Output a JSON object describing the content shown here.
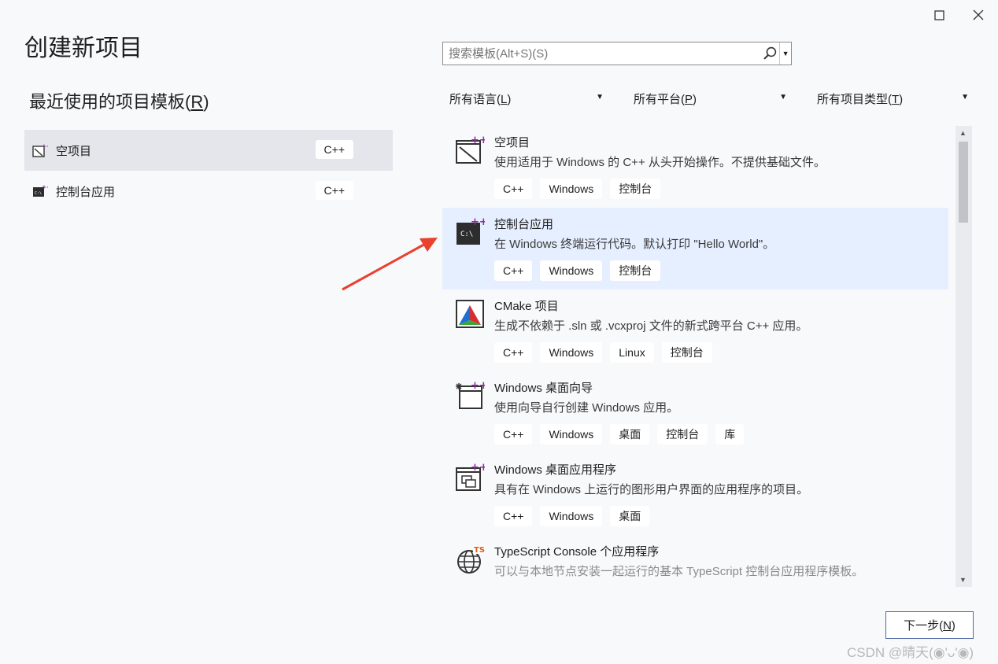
{
  "window": {
    "title": "创建新项目",
    "maximize_icon": "maximize-icon",
    "close_icon": "close-icon"
  },
  "recent": {
    "title_prefix": "最近使用的项目模板(",
    "title_hotkey": "R",
    "title_suffix": ")",
    "items": [
      {
        "label": "空项目",
        "tag": "C++",
        "icon": "empty-project-icon",
        "selected": true
      },
      {
        "label": "控制台应用",
        "tag": "C++",
        "icon": "console-app-icon",
        "selected": false
      }
    ]
  },
  "search": {
    "placeholder": "搜索模板(Alt+S)(S)",
    "icon": "search-icon"
  },
  "filters": {
    "language": {
      "prefix": "所有语言(",
      "hotkey": "L",
      "suffix": ")"
    },
    "platform": {
      "prefix": "所有平台(",
      "hotkey": "P",
      "suffix": ")"
    },
    "project_type": {
      "prefix": "所有项目类型(",
      "hotkey": "T",
      "suffix": ")"
    }
  },
  "templates": [
    {
      "name": "空项目",
      "desc": "使用适用于 Windows 的 C++ 从头开始操作。不提供基础文件。",
      "tags": [
        "C++",
        "Windows",
        "控制台"
      ],
      "icon": "empty-project-icon"
    },
    {
      "name": "控制台应用",
      "desc": "在 Windows 终端运行代码。默认打印 \"Hello World\"。",
      "tags": [
        "C++",
        "Windows",
        "控制台"
      ],
      "icon": "console-app-icon"
    },
    {
      "name": "CMake 项目",
      "desc": "生成不依赖于 .sln 或 .vcxproj 文件的新式跨平台 C++ 应用。",
      "tags": [
        "C++",
        "Windows",
        "Linux",
        "控制台"
      ],
      "icon": "cmake-icon"
    },
    {
      "name": "Windows 桌面向导",
      "desc": "使用向导自行创建 Windows 应用。",
      "tags": [
        "C++",
        "Windows",
        "桌面",
        "控制台",
        "库"
      ],
      "icon": "desktop-wizard-icon"
    },
    {
      "name": "Windows 桌面应用程序",
      "desc": "具有在 Windows 上运行的图形用户界面的应用程序的项目。",
      "tags": [
        "C++",
        "Windows",
        "桌面"
      ],
      "icon": "desktop-app-icon"
    },
    {
      "name": "TypeScript Console 个应用程序",
      "desc": "可以与本地节点安装一起运行的基本 TypeScript 控制台应用程序模板。",
      "tags": [],
      "icon": "typescript-globe-icon"
    }
  ],
  "next_button": {
    "prefix": "下一步(",
    "hotkey": "N",
    "suffix": ")"
  },
  "watermark": "CSDN @晴天(◉'ᴗ'◉)",
  "colors": {
    "highlight": "#e6efff",
    "selected": "#e4e6ec",
    "arrow": "#e8412f"
  }
}
